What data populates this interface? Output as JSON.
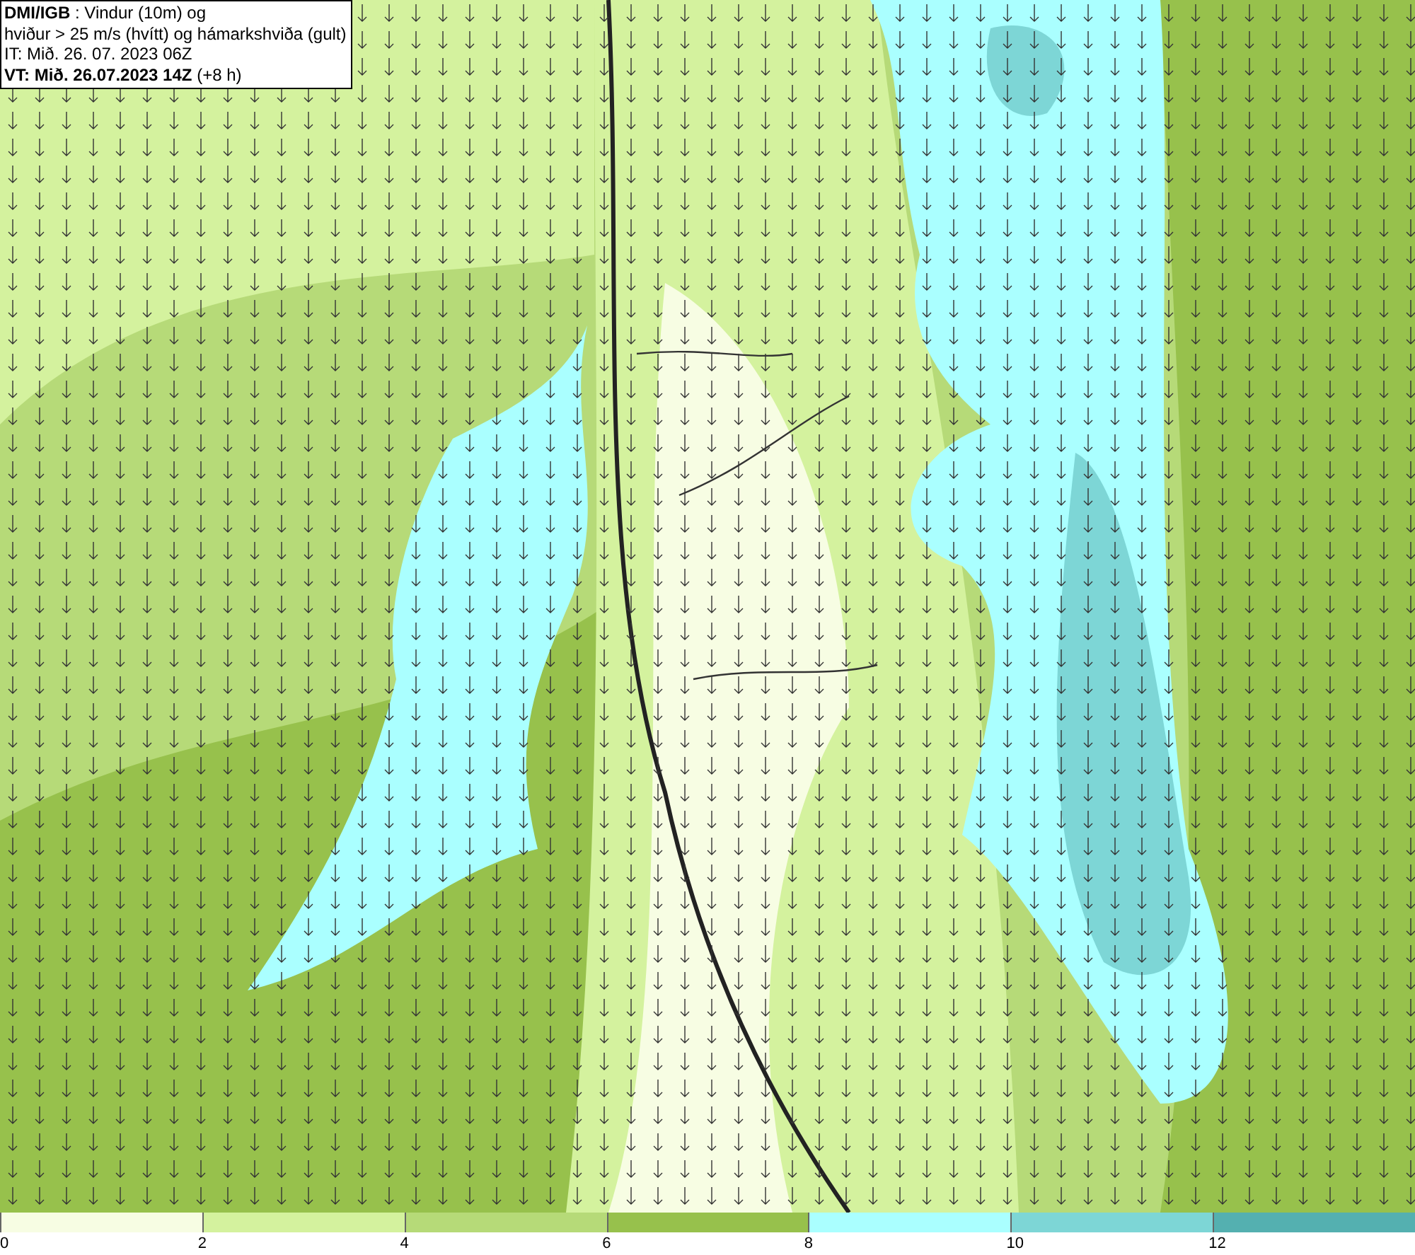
{
  "header": {
    "lines": [
      "**DMI/IGB** : Vindur (10m) og",
      "hviður > 25 m/s (hvítt) og hámarkshviða (gult)",
      "IT: Mið. 26. 07. 2023 06Z",
      "**VT: Mið. 26.07.2023 14Z** (+8 h)"
    ]
  },
  "legend": {
    "bins": [
      {
        "color": "#f7fde3",
        "label": "0"
      },
      {
        "color": "#d4f29e",
        "label": "2"
      },
      {
        "color": "#b6da78",
        "label": "4"
      },
      {
        "color": "#97c14c",
        "label": "6"
      },
      {
        "color": "#aaffff",
        "label": "8"
      },
      {
        "color": "#7dd6d6",
        "label": "10"
      },
      {
        "color": "#54b0b0",
        "label": "12"
      }
    ]
  }
}
